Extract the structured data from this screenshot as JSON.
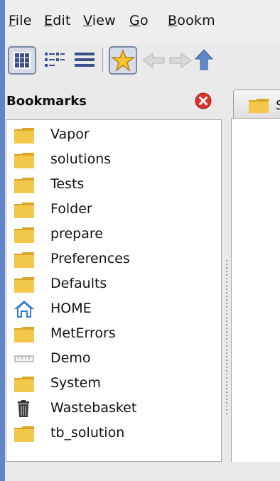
{
  "menubar": {
    "items": [
      {
        "label": "File",
        "mnemonic": "F",
        "rest": "ile"
      },
      {
        "label": "Edit",
        "mnemonic": "E",
        "rest": "dit"
      },
      {
        "label": "View",
        "mnemonic": "V",
        "rest": "iew"
      },
      {
        "label": "Go",
        "mnemonic": "G",
        "rest": "o"
      },
      {
        "label": "Bookm",
        "mnemonic": "B",
        "rest": "ookm"
      }
    ]
  },
  "toolbar": {
    "buttons": [
      {
        "icon": "icon-view-icon",
        "active": true
      },
      {
        "icon": "compact-view-icon",
        "active": false
      },
      {
        "icon": "list-view-icon",
        "active": false
      },
      {
        "icon": "bookmarks-star-icon",
        "active": true
      },
      {
        "icon": "back-arrow-icon",
        "active": false
      },
      {
        "icon": "forward-arrow-icon",
        "active": false
      },
      {
        "icon": "up-arrow-icon",
        "active": false
      }
    ]
  },
  "bookmarks": {
    "title": "Bookmarks",
    "items": [
      {
        "label": "Vapor",
        "icon": "folder-icon"
      },
      {
        "label": "solutions",
        "icon": "folder-icon"
      },
      {
        "label": "Tests",
        "icon": "folder-icon"
      },
      {
        "label": "Folder",
        "icon": "folder-icon"
      },
      {
        "label": "prepare",
        "icon": "folder-icon"
      },
      {
        "label": "Preferences",
        "icon": "folder-icon"
      },
      {
        "label": "Defaults",
        "icon": "folder-icon"
      },
      {
        "label": "HOME",
        "icon": "home-icon"
      },
      {
        "label": "MetErrors",
        "icon": "folder-icon"
      },
      {
        "label": "Demo",
        "icon": "ruler-icon"
      },
      {
        "label": "System",
        "icon": "folder-icon"
      },
      {
        "label": "Wastebasket",
        "icon": "trash-icon"
      },
      {
        "label": "tb_solution",
        "icon": "folder-icon"
      }
    ]
  },
  "tab": {
    "label": "S"
  },
  "colors": {
    "folder": "#f3c84a",
    "folder_dark": "#d9a52a",
    "home": "#2f7fd1",
    "close": "#d9342b",
    "accent_edge": "#5f84c7"
  }
}
